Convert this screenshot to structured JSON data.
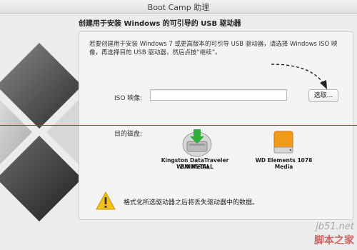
{
  "window": {
    "title": "Boot Camp 助理"
  },
  "heading": "创建用于安装 Windows 的可引导的 USB 驱动器",
  "intro": "若要创建用于安装 Windows 7 或更高版本的可引导 USB 驱动器，请选择 Windows ISO 映像，再选择目的 USB 驱动器，然后点按“继续”。",
  "iso": {
    "label": "ISO 映像:",
    "value": "",
    "choose_button": "选取..."
  },
  "destination": {
    "label": "目的磁盘:",
    "drives": [
      {
        "name_line1": "Kingston DataTraveler 2.0 Media",
        "name_line2": "WININSTALL",
        "icon": "usb-drive-download-icon"
      },
      {
        "name_line1": "WD Elements 1078 Media",
        "icon": "external-drive-orange-icon"
      }
    ]
  },
  "warning": {
    "text": "格式化所选驱动器之后将丢失驱动器中的数据。",
    "icon": "warning-triangle-icon"
  },
  "watermark": {
    "line1": "jb51.net",
    "line2": "脚本之家"
  },
  "colors": {
    "annotation_line": "#e02020",
    "accent_green": "#2fae3a",
    "drive_orange": "#f29a1a"
  }
}
